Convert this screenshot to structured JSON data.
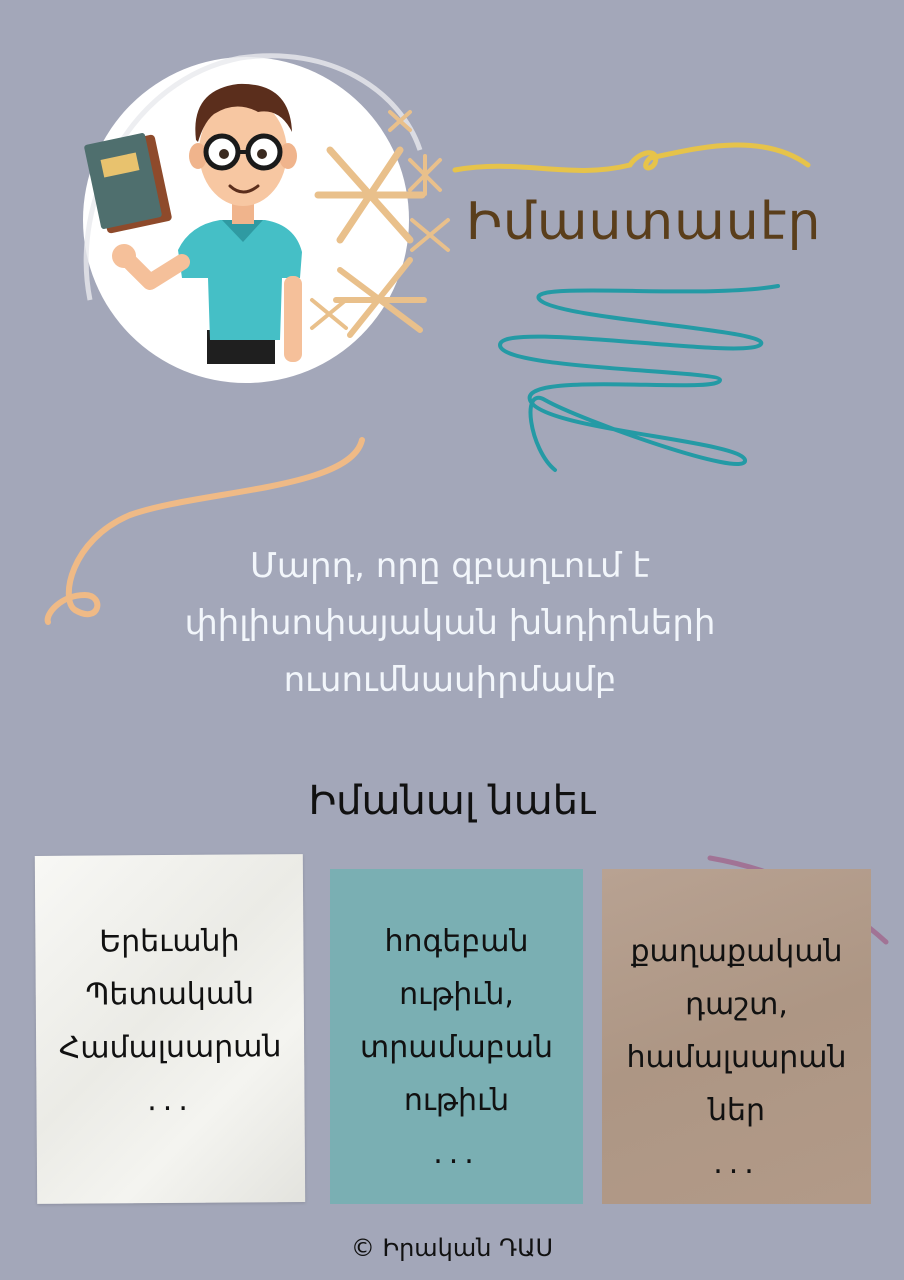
{
  "header": {
    "title": "Իմաստասէր"
  },
  "definition": {
    "lines": [
      "Մարդ, որը զբաղւում է",
      "փիլիսոփայական խնդիրների",
      "ուսումնասիրմամբ"
    ]
  },
  "see_also": {
    "heading": "Իմանալ նաեւ",
    "cards": [
      {
        "lines": [
          "Երեւանի",
          "Պետական",
          "Համալսարան"
        ],
        "ellipsis": "..."
      },
      {
        "lines": [
          "հոգեբան",
          "ութիւն,",
          "տրամաբան",
          "ութիւն"
        ],
        "ellipsis": "..."
      },
      {
        "lines": [
          "քաղաքական",
          "դաշտ,",
          "համալսարան",
          "ներ"
        ],
        "ellipsis": "..."
      }
    ]
  },
  "footer": {
    "credit": "© Իրական ԴԱՍ"
  },
  "colors": {
    "background": "#a3a7b9",
    "title": "#5a3e1b",
    "teal_card": "#7aafb3",
    "brown_card": "#b29a88",
    "definition_text": "#f2f6fb"
  },
  "icons": [
    "teacher-illustration",
    "book-icon",
    "sparkle-icon",
    "squiggle-decoration"
  ]
}
